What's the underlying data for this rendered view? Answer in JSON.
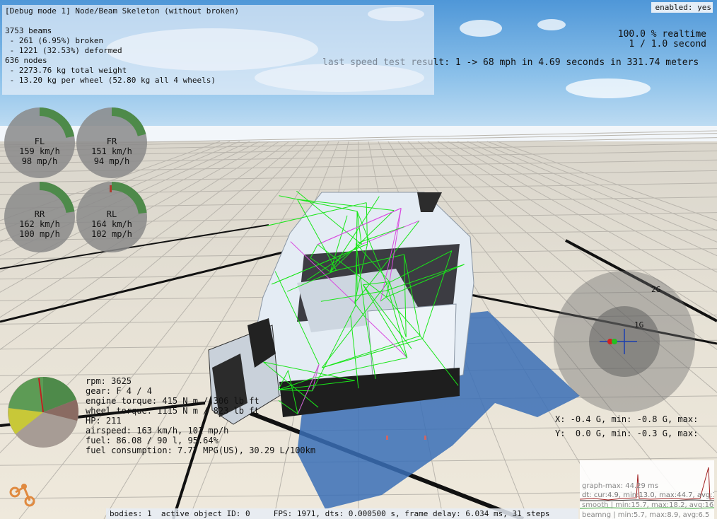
{
  "debug": {
    "title": "[Debug mode 1] Node/Beam Skeleton (without broken)",
    "beams": "3753 beams",
    "broken": " - 261 (6.95%) broken",
    "deformed": " - 1221 (32.53%) deformed",
    "nodes": "636 nodes",
    "total_weight": " - 2273.76 kg total weight",
    "per_wheel": " - 13.20 kg per wheel (52.80 kg all 4 wheels)"
  },
  "enabled": "enabled: yes",
  "realtime": {
    "line1": "100.0 % realtime",
    "line2": "1 / 1.0 second"
  },
  "speed_test": {
    "faded": "last speed test resu",
    "main": "lt: 1 -> 68 mph in 4.69 seconds in 331.74 meters"
  },
  "wheels": [
    {
      "name": "FL",
      "kmh": "159 km/h",
      "mph": "98 mp/h",
      "level": 0.44
    },
    {
      "name": "FR",
      "kmh": "151 km/h",
      "mph": "94 mp/h",
      "level": 0.42
    },
    {
      "name": "RR",
      "kmh": "162 km/h",
      "mph": "100 mp/h",
      "level": 0.45
    },
    {
      "name": "RL",
      "kmh": "164 km/h",
      "mph": "102 mp/h",
      "level": 0.46
    }
  ],
  "engine": {
    "rpm": "rpm: 3625",
    "gear": "gear: F 4 / 4",
    "engine_torque": "engine torque: 415 N m / 306 lb ft",
    "wheel_torque": "wheel torque: 1115 N m / 823 lb ft",
    "hp": "HP: 211",
    "airspeed": "airspeed: 163 km/h, 101 mp/h",
    "fuel": "fuel: 86.08 / 90 l, 95.64%",
    "consumption": "fuel consumption: 7.77 MPG(US), 30.29 L/100km"
  },
  "gforce": {
    "ring_2g": "2G",
    "ring_1g": "1G",
    "x": "X: -0.4 G, min: -0.8 G, max:",
    "y": "Y:  0.0 G, min: -0.3 G, max:"
  },
  "graph": {
    "max": "graph-max: 44.29 ms",
    "line2": "dt: cur:4.9, min:13.0, max:44.7, avg:16.6",
    "smooth": "smooth | min:15.7, max:18.2, avg:16.6",
    "beamng": "beamng | min:5.7, max:8.9, avg:6.5"
  },
  "status": "bodies: 1  active object ID: 0     FPS: 1971, dts: 0.000500 s, frame delay: 6.034 ms, 31 steps",
  "colors": {
    "gauge_green": "#4e8a4a",
    "gauge_bg": "#8a8a8a",
    "beam_green": "#19e619",
    "beam_magenta": "#d94ce0",
    "grid_black": "#111111"
  }
}
